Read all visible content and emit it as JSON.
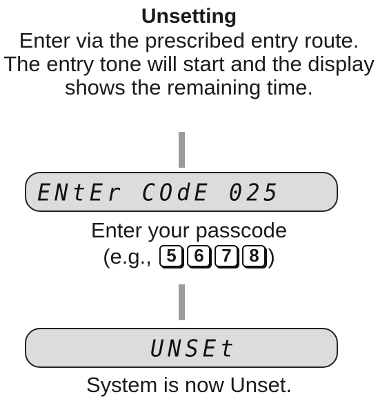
{
  "heading": "Unsetting",
  "intro": "Enter via the prescribed entry route. The entry tone will start and the display shows the remaining time.",
  "display_1": "ENtEr COdE 025",
  "step_1": {
    "line_1": "Enter your passcode",
    "prefix": "(e.g.,",
    "keys": [
      "5",
      "6",
      "7",
      "8"
    ],
    "suffix": ")"
  },
  "display_2": "UNSEt",
  "result": "System is now Unset.",
  "colors": {
    "display_background": "#dcdcdc",
    "connector": "#9b9b9b"
  }
}
